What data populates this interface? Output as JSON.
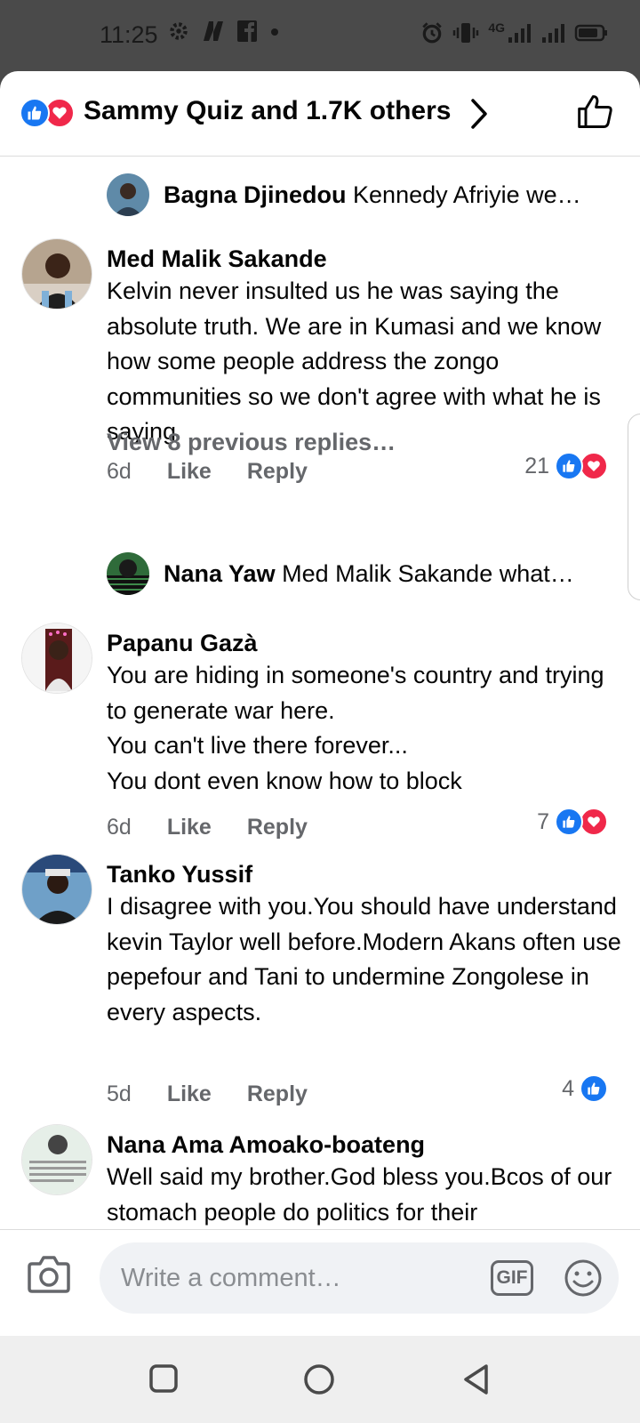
{
  "status_bar": {
    "time": "11:25",
    "network_label": "4G"
  },
  "header": {
    "reactions_summary": "Sammy Quiz and 1.7K others"
  },
  "replies_preview": [
    {
      "name": "Bagna Djinedou",
      "text": "Kennedy Afriyie  we…"
    },
    {
      "name": "Nana Yaw",
      "text": "Med Malik Sakande what…"
    }
  ],
  "comments": [
    {
      "name": "Med Malik Sakande",
      "body": "Kelvin never insulted us he was saying the absolute truth. We are in Kumasi and we know how some people address the zongo communities so we don't agree with what he is saying",
      "time": "6d",
      "like_label": "Like",
      "reply_label": "Reply",
      "reaction_count": "21"
    },
    {
      "name": "Papanu Gazà",
      "body_lines": [
        "You are hiding in someone's country and trying to generate war here.",
        "You can't live there forever...",
        "You dont even know how to block"
      ],
      "time": "6d",
      "like_label": "Like",
      "reply_label": "Reply",
      "reaction_count": "7"
    },
    {
      "name": "Tanko Yussif",
      "body": "I disagree with you.You should have understand  kevin Taylor well before.Modern Akans often use pepefour and Tani to undermine Zongolese in every aspects.",
      "time": "5d",
      "like_label": "Like",
      "reply_label": "Reply",
      "reaction_count": "4"
    },
    {
      "name": "Nana Ama Amoako-boateng",
      "body": "Well said my brother.God bless you.Bcos of our stomach people do politics for their"
    }
  ],
  "view_previous": "View 8 previous replies…",
  "composer": {
    "placeholder": "Write a comment…",
    "gif_label": "GIF"
  },
  "colors": {
    "like_blue": "#1877f2",
    "love_red": "#f0284a",
    "meta_gray": "#65676b"
  }
}
